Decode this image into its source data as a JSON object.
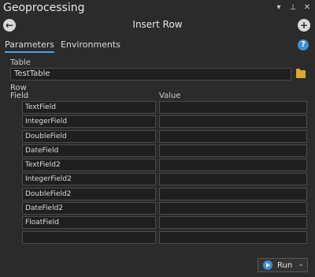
{
  "app": {
    "title": "Geoprocessing"
  },
  "titlebar_icons": [
    "chevron-down-icon",
    "pin-icon",
    "close-icon"
  ],
  "tool": {
    "title": "Insert Row"
  },
  "tabs": [
    {
      "label": "Parameters",
      "active": true
    },
    {
      "label": "Environments",
      "active": false
    }
  ],
  "parameters": {
    "table_label": "Table",
    "table_value": "TestTable",
    "row_label": "Row",
    "field_header": "Field",
    "value_header": "Value",
    "rows": [
      {
        "field": "TextField",
        "value": ""
      },
      {
        "field": "IntegerField",
        "value": ""
      },
      {
        "field": "DoubleField",
        "value": ""
      },
      {
        "field": "DateField",
        "value": ""
      },
      {
        "field": "TextField2",
        "value": ""
      },
      {
        "field": "IntegerField2",
        "value": ""
      },
      {
        "field": "DoubleField2",
        "value": ""
      },
      {
        "field": "DateField2",
        "value": ""
      },
      {
        "field": "FloatField",
        "value": ""
      },
      {
        "field": "",
        "value": ""
      }
    ]
  },
  "footer": {
    "run_label": "Run"
  },
  "colors": {
    "accent": "#3b8fd6",
    "tab_underline": "#4aa3df",
    "folder": "#e0a82e"
  }
}
